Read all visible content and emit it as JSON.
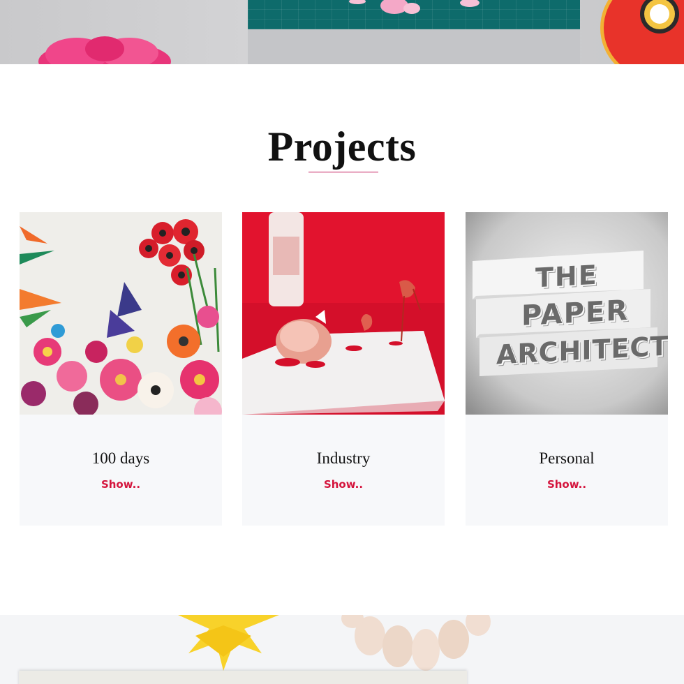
{
  "section": {
    "title": "Projects"
  },
  "cards": [
    {
      "title": "100 days",
      "link": "Show..",
      "image": "paper-flowers-collage"
    },
    {
      "title": "Industry",
      "link": "Show..",
      "image": "red-popup-card-apple"
    },
    {
      "title": "Personal",
      "link": "Show..",
      "image": "paper-architect-stairs"
    }
  ],
  "colors": {
    "accent": "#d4143c",
    "underline": "#c2185b",
    "card_bg": "#f7f8fa",
    "text": "#111111"
  }
}
